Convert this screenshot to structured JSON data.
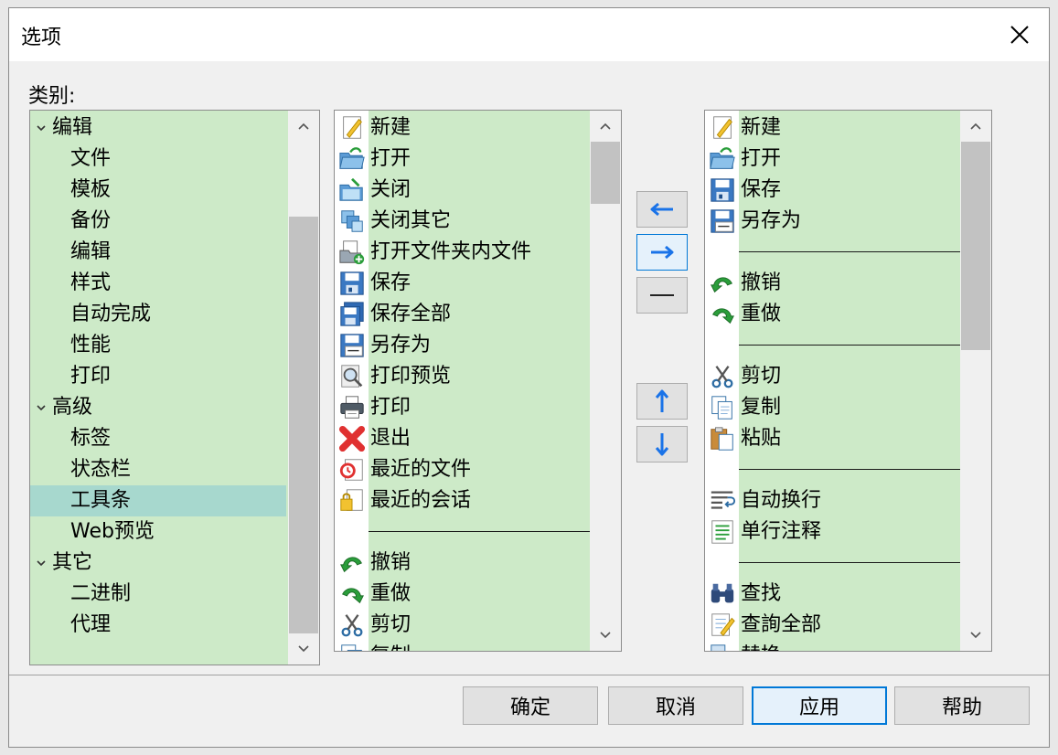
{
  "window": {
    "title": "选项"
  },
  "category_label": "类别:",
  "tree": [
    {
      "label": "编辑",
      "level": 0,
      "expanded": true
    },
    {
      "label": "文件",
      "level": 1
    },
    {
      "label": "模板",
      "level": 1
    },
    {
      "label": "备份",
      "level": 1
    },
    {
      "label": "编辑",
      "level": 1
    },
    {
      "label": "样式",
      "level": 1
    },
    {
      "label": "自动完成",
      "level": 1
    },
    {
      "label": "性能",
      "level": 1
    },
    {
      "label": "打印",
      "level": 1
    },
    {
      "label": "高级",
      "level": 0,
      "expanded": true
    },
    {
      "label": "标签",
      "level": 1
    },
    {
      "label": "状态栏",
      "level": 1
    },
    {
      "label": "工具条",
      "level": 1,
      "selected": true
    },
    {
      "label": "Web预览",
      "level": 1
    },
    {
      "label": "其它",
      "level": 0,
      "expanded": true
    },
    {
      "label": "二进制",
      "level": 1
    },
    {
      "label": "代理",
      "level": 1
    }
  ],
  "available": [
    {
      "label": "新建",
      "icon": "new-icon"
    },
    {
      "label": "打开",
      "icon": "open-folder-icon"
    },
    {
      "label": "关闭",
      "icon": "close-file-icon"
    },
    {
      "label": "关闭其它",
      "icon": "close-others-icon"
    },
    {
      "label": "打开文件夹内文件",
      "icon": "open-folder-files-icon"
    },
    {
      "label": "保存",
      "icon": "save-icon"
    },
    {
      "label": "保存全部",
      "icon": "save-all-icon"
    },
    {
      "label": "另存为",
      "icon": "save-as-icon"
    },
    {
      "label": "打印预览",
      "icon": "print-preview-icon"
    },
    {
      "label": "打印",
      "icon": "printer-icon"
    },
    {
      "label": "退出",
      "icon": "exit-icon"
    },
    {
      "label": "最近的文件",
      "icon": "recent-files-icon"
    },
    {
      "label": "最近的会话",
      "icon": "recent-sessions-icon"
    },
    {
      "separator": true
    },
    {
      "label": "撤销",
      "icon": "undo-icon"
    },
    {
      "label": "重做",
      "icon": "redo-icon"
    },
    {
      "label": "剪切",
      "icon": "cut-icon"
    },
    {
      "label": "复制",
      "icon": "copy-icon"
    }
  ],
  "current": [
    {
      "label": "新建",
      "icon": "new-icon"
    },
    {
      "label": "打开",
      "icon": "open-folder-icon"
    },
    {
      "label": "保存",
      "icon": "save-icon"
    },
    {
      "label": "另存为",
      "icon": "save-as-icon"
    },
    {
      "separator": true
    },
    {
      "label": "撤销",
      "icon": "undo-icon"
    },
    {
      "label": "重做",
      "icon": "redo-icon"
    },
    {
      "separator": true
    },
    {
      "label": "剪切",
      "icon": "cut-icon"
    },
    {
      "label": "复制",
      "icon": "copy-icon"
    },
    {
      "label": "粘贴",
      "icon": "paste-icon"
    },
    {
      "separator": true
    },
    {
      "label": "自动换行",
      "icon": "word-wrap-icon"
    },
    {
      "label": "单行注释",
      "icon": "line-comment-icon"
    },
    {
      "separator": true
    },
    {
      "label": "查找",
      "icon": "find-icon"
    },
    {
      "label": "查詢全部",
      "icon": "find-all-icon"
    },
    {
      "label": "替换",
      "icon": "replace-icon"
    }
  ],
  "buttons": {
    "ok": "确定",
    "cancel": "取消",
    "apply": "应用",
    "help": "帮助"
  },
  "colors": {
    "list_bg": "#cdeac8",
    "selected": "#a7d8ce",
    "accent": "#0078d7",
    "arrow": "#1a73e8"
  }
}
